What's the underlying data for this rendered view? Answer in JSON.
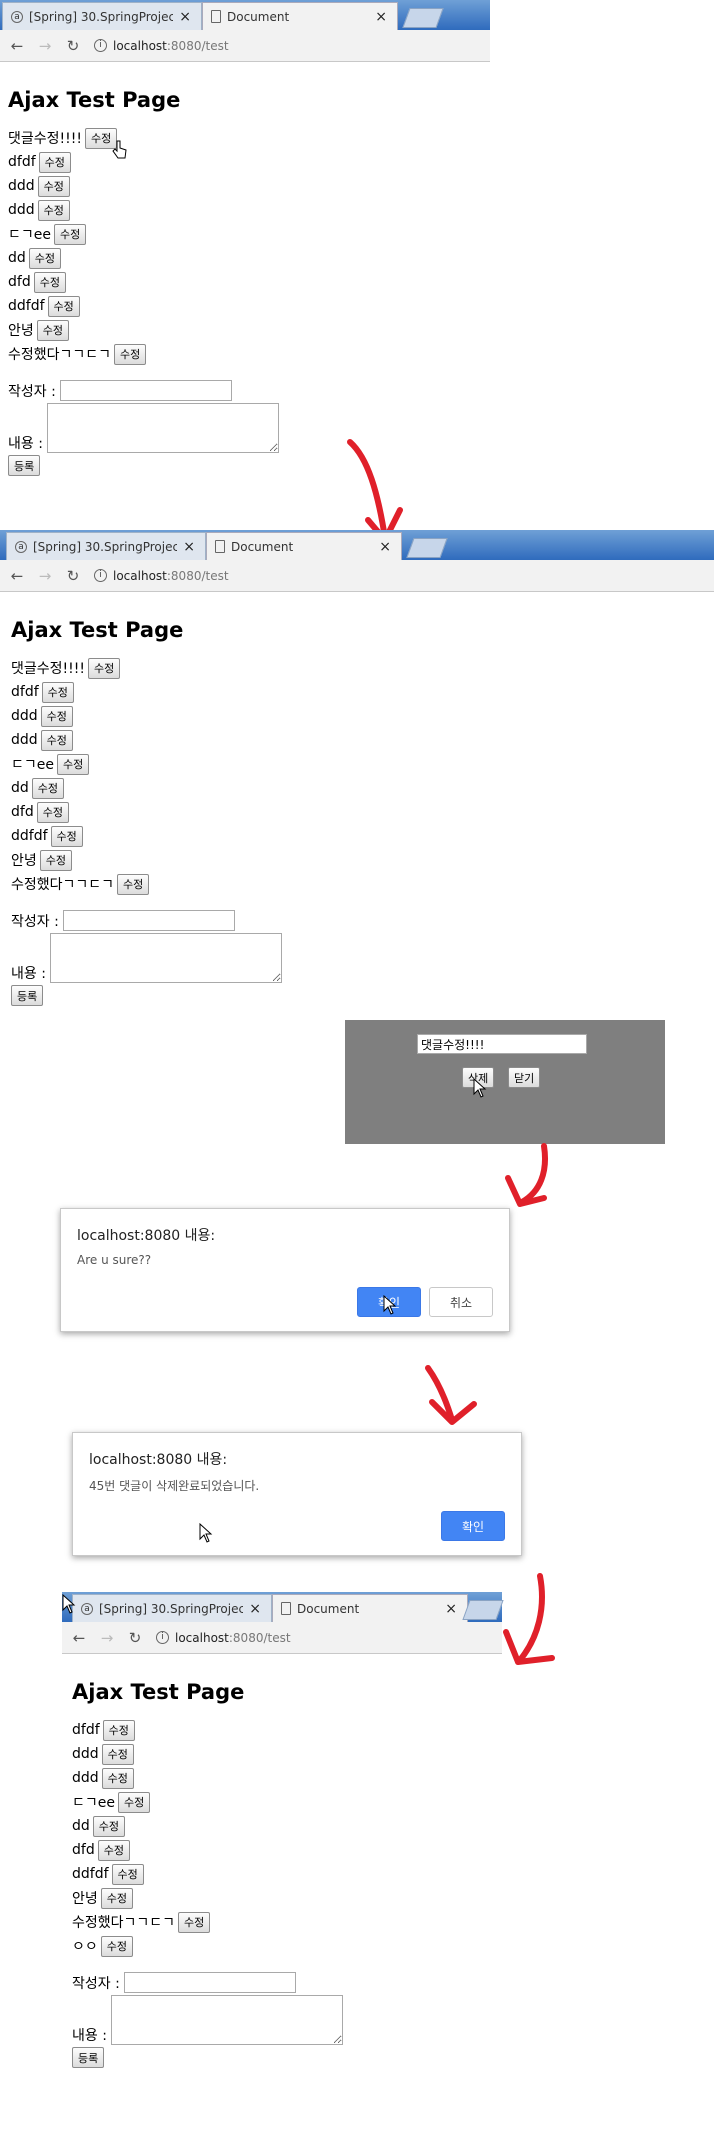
{
  "browser": {
    "tab_inactive_title": "[Spring] 30.SpringProject",
    "tab_active_title": "Document",
    "url_host": "localhost",
    "url_path": ":8080/test"
  },
  "page": {
    "title": "Ajax Test Page",
    "edit_label": "수정",
    "writer_label": "작성자 :",
    "content_label": "내용 :",
    "submit_label": "등록"
  },
  "replies_before": [
    "댓글수정!!!!",
    "dfdf",
    "ddd",
    "ddd",
    "ㄷㄱee",
    "dd",
    "dfd",
    "ddfdf",
    "안녕",
    "수정했다ㄱㄱㄷㄱ"
  ],
  "replies_after": [
    "dfdf",
    "ddd",
    "ddd",
    "ㄷㄱee",
    "dd",
    "dfd",
    "ddfdf",
    "안녕",
    "수정했다ㄱㄱㄷㄱ",
    "ㅇㅇ"
  ],
  "modal": {
    "reply_text": "댓글수정!!!!",
    "delete_label": "삭제",
    "close_label": "닫기"
  },
  "confirm_dialog": {
    "title": "localhost:8080 내용:",
    "message": "Are u sure??",
    "ok_label": "확인",
    "cancel_label": "취소"
  },
  "alert_dialog": {
    "title": "localhost:8080 내용:",
    "message": "45번 댓글이 삭제완료되었습니다.",
    "ok_label": "확인"
  },
  "colors": {
    "accent_button": "#4285f4",
    "modal_overlay": "#7f7f7f",
    "annotation_arrow": "#e0202a"
  }
}
